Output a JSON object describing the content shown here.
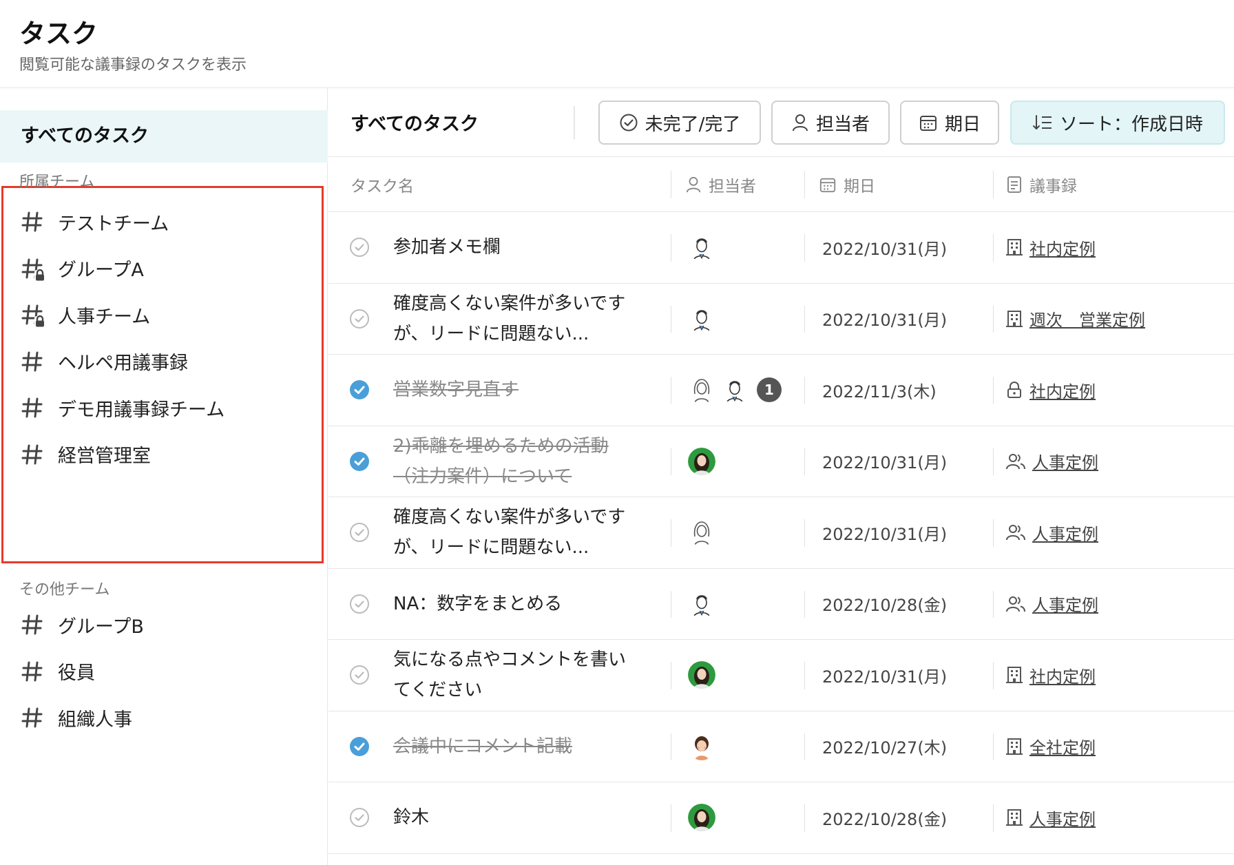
{
  "header": {
    "title": "タスク",
    "subtitle": "閲覧可能な議事録のタスクを表示"
  },
  "sidebar": {
    "all_tasks": "すべてのタスク",
    "my_teams_label": "所属チーム",
    "my_teams": [
      {
        "label": "テストチーム",
        "icon": "hash-icon"
      },
      {
        "label": "グループA",
        "icon": "hash-lock-icon"
      },
      {
        "label": "人事チーム",
        "icon": "hash-lock-icon"
      },
      {
        "label": "ヘルペ用議事録",
        "icon": "hash-icon"
      },
      {
        "label": "デモ用議事録チーム",
        "icon": "hash-icon"
      },
      {
        "label": "経営管理室",
        "icon": "hash-icon"
      }
    ],
    "other_teams_label": "その他チーム",
    "other_teams": [
      {
        "label": "グループB",
        "icon": "hash-icon"
      },
      {
        "label": "役員",
        "icon": "hash-icon"
      },
      {
        "label": "組織人事",
        "icon": "hash-icon"
      }
    ]
  },
  "toolbar": {
    "title": "すべてのタスク",
    "status_filter": "未完了/完了",
    "assignee_filter": "担当者",
    "due_filter": "期日",
    "sort": "ソート：作成日時"
  },
  "table": {
    "headers": {
      "name": "タスク名",
      "assignee": "担当者",
      "due": "期日",
      "minutes": "議事録"
    },
    "rows": [
      {
        "name": "参加者メモ欄",
        "done": false,
        "avatars": [
          "avatar-man-sketch"
        ],
        "extra_count": "",
        "due": "2022/10/31(月)",
        "minutes_icon": "building-icon",
        "minutes": "社内定例"
      },
      {
        "name": "確度高くない案件が多いですが、リードに問題ない...",
        "done": false,
        "avatars": [
          "avatar-man-sketch"
        ],
        "extra_count": "",
        "due": "2022/10/31(月)",
        "minutes_icon": "building-icon",
        "minutes": "週次　営業定例"
      },
      {
        "name": "営業数字見直す",
        "done": true,
        "avatars": [
          "avatar-woman-sketch",
          "avatar-man-sketch"
        ],
        "extra_count": "1",
        "due": "2022/11/3(木)",
        "minutes_icon": "lock-icon",
        "minutes": "社内定例"
      },
      {
        "name": "2)乖離を埋めるための活動（注力案件）について",
        "done": true,
        "avatars": [
          "avatar-woman-photo"
        ],
        "extra_count": "",
        "due": "2022/10/31(月)",
        "minutes_icon": "people-icon",
        "minutes": "人事定例"
      },
      {
        "name": "確度高くない案件が多いですが、リードに問題ない...",
        "done": false,
        "avatars": [
          "avatar-woman-sketch"
        ],
        "extra_count": "",
        "due": "2022/10/31(月)",
        "minutes_icon": "people-icon",
        "minutes": "人事定例"
      },
      {
        "name": "NA：数字をまとめる",
        "done": false,
        "avatars": [
          "avatar-man-sketch"
        ],
        "extra_count": "",
        "due": "2022/10/28(金)",
        "minutes_icon": "people-icon",
        "minutes": "人事定例"
      },
      {
        "name": "気になる点やコメントを書いてください",
        "done": false,
        "avatars": [
          "avatar-woman-photo"
        ],
        "extra_count": "",
        "due": "2022/10/31(月)",
        "minutes_icon": "building-icon",
        "minutes": "社内定例"
      },
      {
        "name": "会議中にコメント記載",
        "done": true,
        "avatars": [
          "avatar-woman-color"
        ],
        "extra_count": "",
        "due": "2022/10/27(木)",
        "minutes_icon": "building-icon",
        "minutes": "全社定例"
      },
      {
        "name": "鈴木",
        "done": false,
        "avatars": [
          "avatar-woman-photo"
        ],
        "extra_count": "",
        "due": "2022/10/28(金)",
        "minutes_icon": "building-icon",
        "minutes": "人事定例"
      }
    ]
  },
  "colors": {
    "accent": "#4a9fd8",
    "highlight_border": "#e53a2a",
    "selected_bg": "#eaf6f8"
  }
}
